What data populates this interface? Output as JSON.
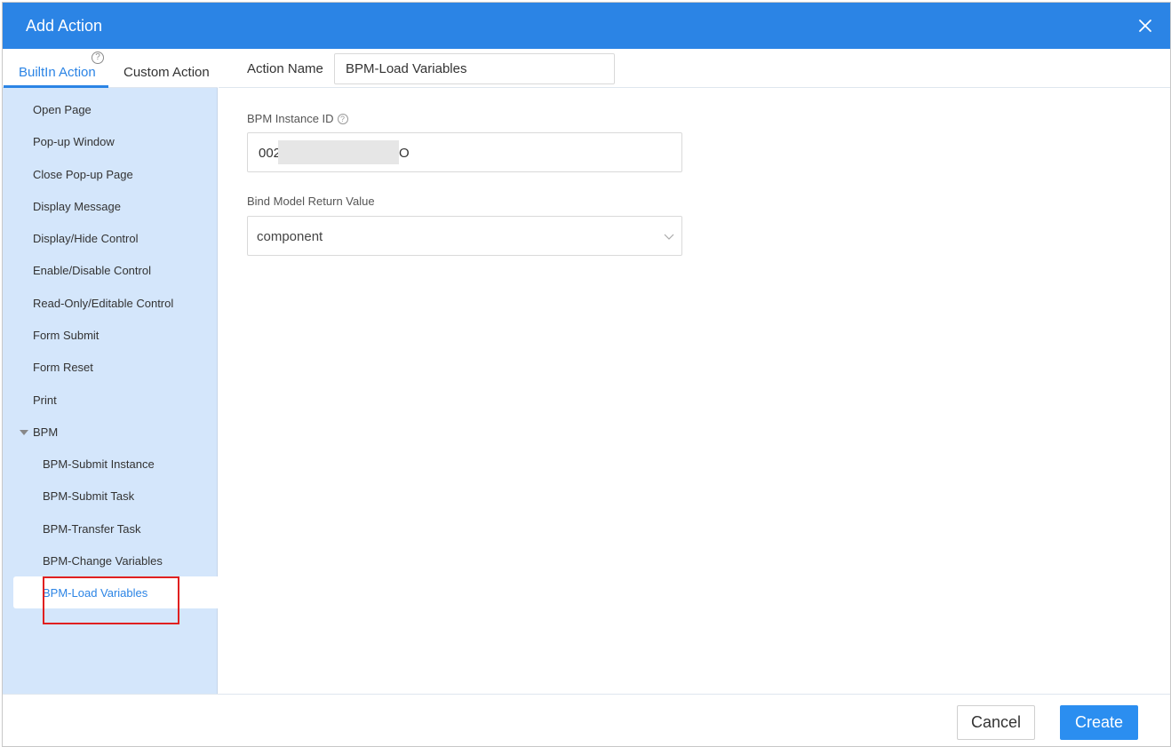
{
  "header": {
    "title": "Add Action",
    "close_icon": "close-icon"
  },
  "sidebar": {
    "tabs": [
      {
        "label": "BuiltIn Action",
        "active": true,
        "help_icon": "question-circle-icon",
        "help_glyph": "?"
      },
      {
        "label": "Custom Action",
        "active": false
      }
    ],
    "items": [
      {
        "label": "Open Page"
      },
      {
        "label": "Pop-up Window"
      },
      {
        "label": "Close Pop-up Page"
      },
      {
        "label": "Display Message"
      },
      {
        "label": "Display/Hide Control"
      },
      {
        "label": "Enable/Disable Control"
      },
      {
        "label": "Read-Only/Editable Control"
      },
      {
        "label": "Form Submit"
      },
      {
        "label": "Form Reset"
      },
      {
        "label": "Print"
      },
      {
        "label": "BPM",
        "group": true,
        "expanded": true,
        "icon": "caret-down-icon"
      },
      {
        "label": "BPM-Submit Instance"
      },
      {
        "label": "BPM-Submit Task"
      },
      {
        "label": "BPM-Transfer Task"
      },
      {
        "label": "BPM-Change Variables"
      },
      {
        "label": "BPM-Load Variables",
        "selected": true
      }
    ]
  },
  "main": {
    "action_name_label": "Action Name",
    "action_name_value": "BPM-Load Variables",
    "instance_id_label": "BPM Instance ID",
    "instance_id_help_glyph": "?",
    "instance_id_value_start": "002",
    "instance_id_value_end": "O",
    "bind_label": "Bind Model Return Value",
    "bind_value": "component",
    "bind_icon": "chevron-down-icon"
  },
  "footer": {
    "cancel_label": "Cancel",
    "create_label": "Create"
  },
  "colors": {
    "primary": "#2b84e5",
    "sidebar_bg": "#d4e6fb",
    "highlight": "#e02020"
  }
}
